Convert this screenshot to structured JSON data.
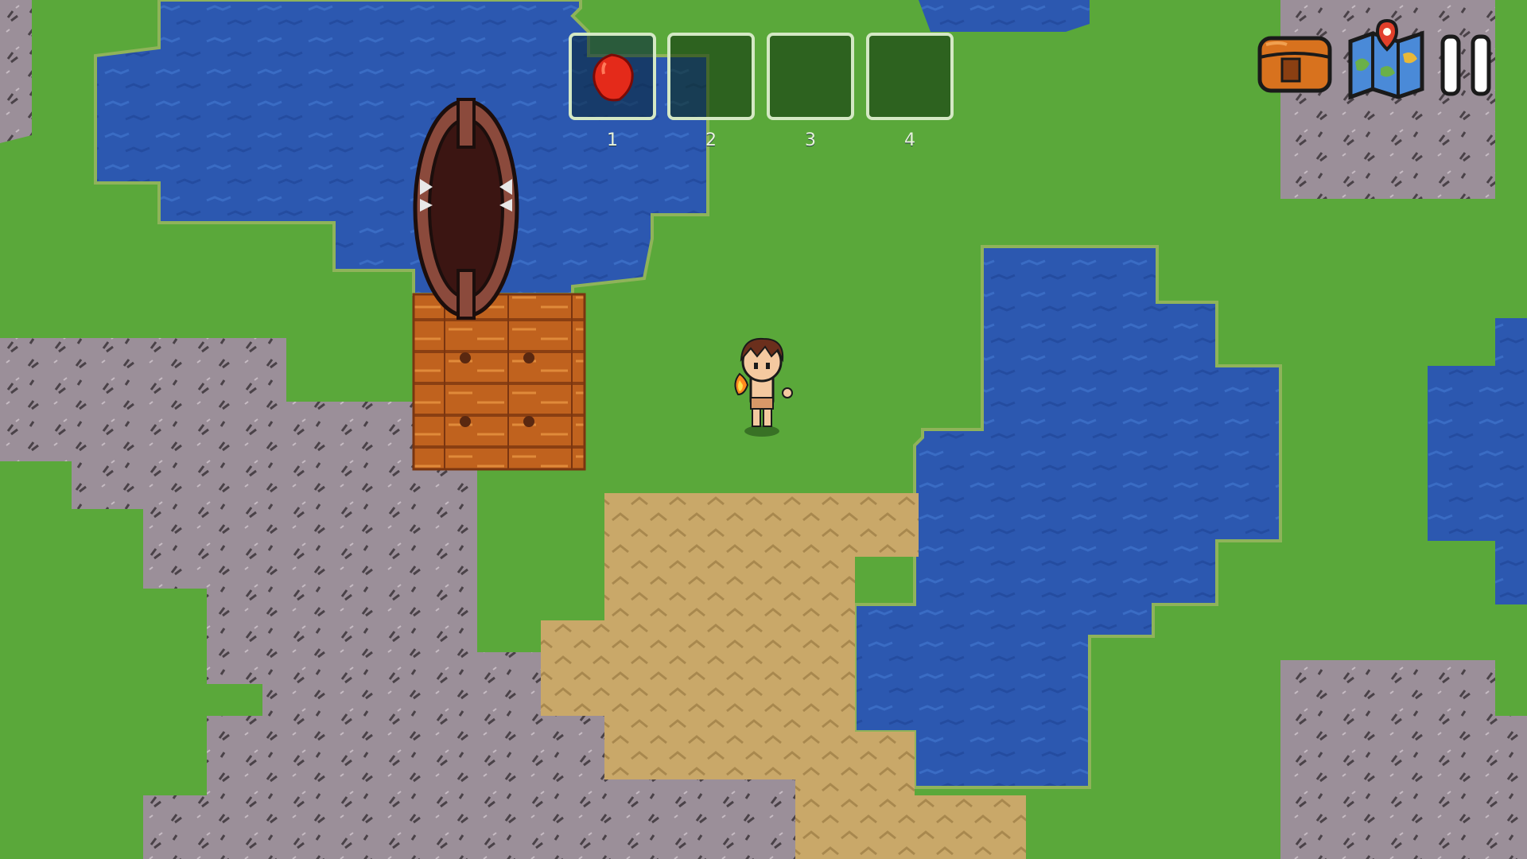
{
  "hotbar": {
    "slots": [
      {
        "number": "1",
        "item": "red-berry-icon",
        "selected": true
      },
      {
        "number": "2",
        "item": "",
        "selected": false
      },
      {
        "number": "3",
        "item": "",
        "selected": false
      },
      {
        "number": "4",
        "item": "",
        "selected": false
      }
    ]
  },
  "top_right_buttons": [
    {
      "icon": "backpack-icon"
    },
    {
      "icon": "map-icon"
    },
    {
      "icon": "pause-icon"
    }
  ],
  "colors": {
    "grass": "#5aa83a",
    "water": "#2c58b0",
    "rock": "#9b8f99",
    "sand": "#c9a869",
    "wood": "#c0621e",
    "boat": "#5a2a22"
  }
}
